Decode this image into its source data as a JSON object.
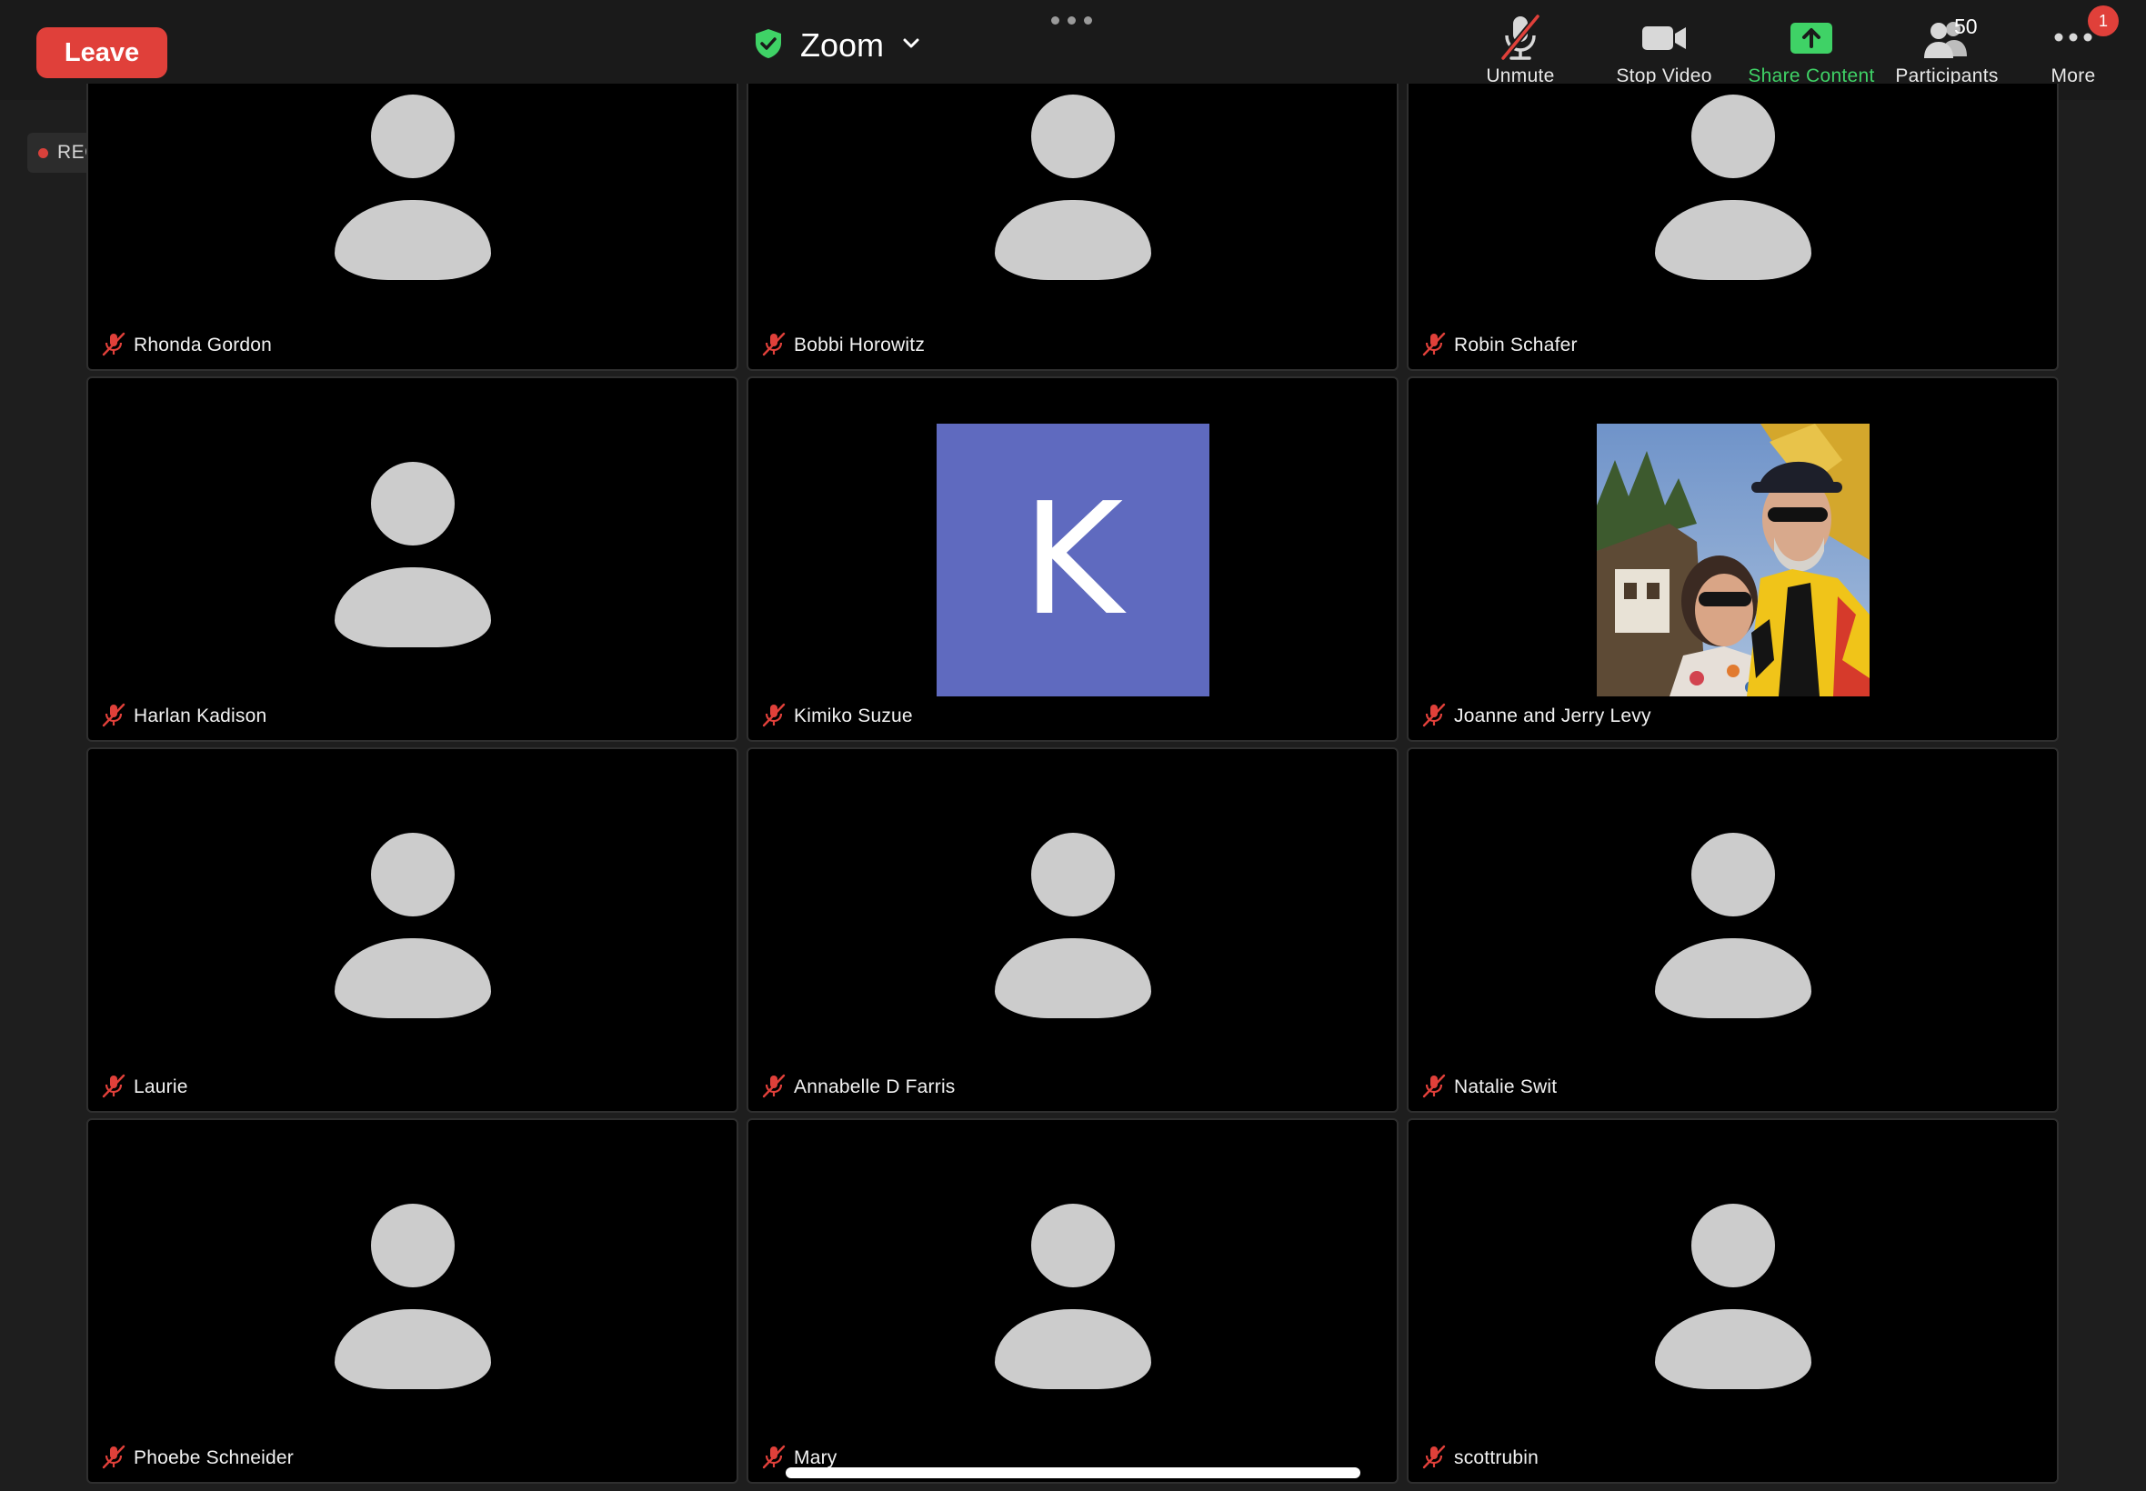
{
  "topbar": {
    "leave_label": "Leave",
    "meeting_title": "Zoom",
    "unmute_label": "Unmute",
    "stop_video_label": "Stop Video",
    "share_label": "Share Content",
    "participants_label": "Participants",
    "participants_count": "50",
    "more_label": "More",
    "more_badge": "1"
  },
  "recording": {
    "label": "REC"
  },
  "colors": {
    "leave": "#e0403a",
    "share_green": "#3fd266",
    "shield_green": "#3fd266",
    "muted_red": "#e0403a",
    "k_avatar_bg": "#5f6abf"
  },
  "participants": [
    {
      "name": "Rhonda Gordon",
      "avatar": "person-placeholder"
    },
    {
      "name": "Bobbi Horowitz",
      "avatar": "person-placeholder"
    },
    {
      "name": "Robin Schafer",
      "avatar": "person-placeholder"
    },
    {
      "name": "Harlan Kadison",
      "avatar": "person-placeholder"
    },
    {
      "name": "Kimiko Suzue",
      "avatar": "initial",
      "initial": "K"
    },
    {
      "name": "Joanne and Jerry Levy",
      "avatar": "photo"
    },
    {
      "name": "Laurie",
      "avatar": "person-placeholder"
    },
    {
      "name": "Annabelle D Farris",
      "avatar": "person-placeholder"
    },
    {
      "name": "Natalie Swit",
      "avatar": "person-placeholder"
    },
    {
      "name": "Phoebe Schneider",
      "avatar": "person-placeholder"
    },
    {
      "name": "Mary",
      "avatar": "person-placeholder"
    },
    {
      "name": "scottrubin",
      "avatar": "person-placeholder"
    }
  ]
}
